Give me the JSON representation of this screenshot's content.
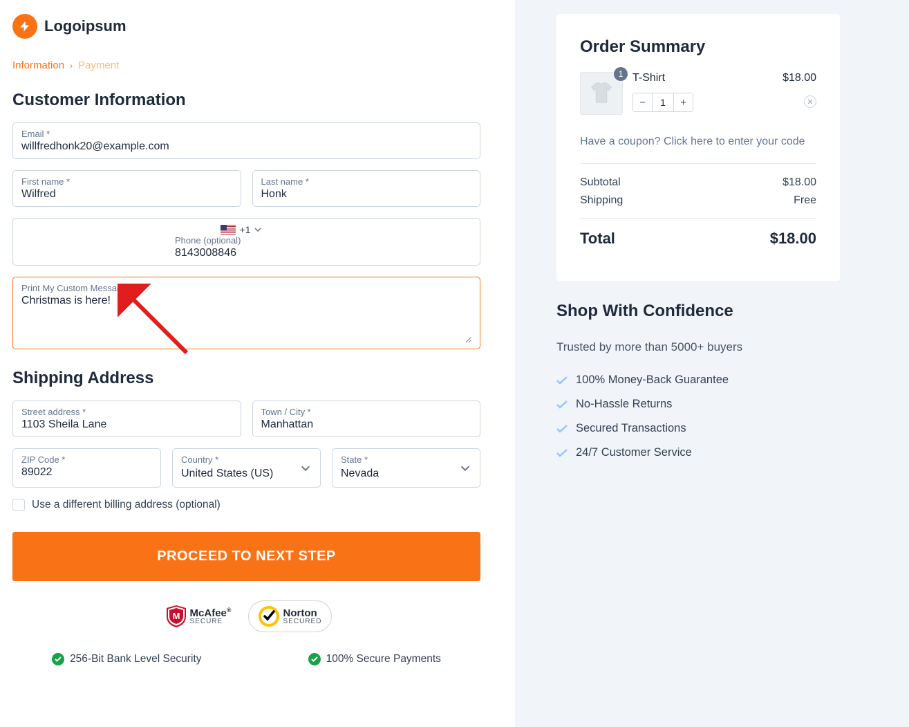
{
  "brand": {
    "name": "Logoipsum"
  },
  "breadcrumb": {
    "step1": "Information",
    "step2": "Payment"
  },
  "sections": {
    "customer_info": "Customer Information",
    "shipping": "Shipping Address"
  },
  "fields": {
    "email": {
      "label": "Email *",
      "value": "willfredhonk20@example.com"
    },
    "first_name": {
      "label": "First name *",
      "value": "Wilfred"
    },
    "last_name": {
      "label": "Last name *",
      "value": "Honk"
    },
    "phone": {
      "label": "Phone (optional)",
      "value": "8143008846",
      "dial": "+1"
    },
    "custom_msg": {
      "label": "Print My Custom Message *",
      "value": "Christmas is here!"
    },
    "street": {
      "label": "Street address *",
      "value": "1103 Sheila Lane"
    },
    "city": {
      "label": "Town / City *",
      "value": "Manhattan"
    },
    "zip": {
      "label": "ZIP Code *",
      "value": "89022"
    },
    "country": {
      "label": "Country *",
      "value": "United States (US)"
    },
    "state": {
      "label": "State *",
      "value": "Nevada"
    },
    "billing_checkbox": "Use a different billing address (optional)"
  },
  "cta": "PROCEED TO NEXT STEP",
  "trust_badges": {
    "mcafee": {
      "main": "McAfee",
      "sub": "SECURE"
    },
    "norton": {
      "main": "Norton",
      "sub": "SECURED"
    }
  },
  "security": {
    "bank": "256-Bit Bank Level Security",
    "payments": "100% Secure Payments"
  },
  "summary": {
    "title": "Order Summary",
    "item": {
      "name": "T-Shirt",
      "price": "$18.00",
      "qty": "1",
      "badge": "1"
    },
    "coupon": "Have a coupon? Click here to enter your code",
    "subtotal_label": "Subtotal",
    "subtotal": "$18.00",
    "shipping_label": "Shipping",
    "shipping": "Free",
    "total_label": "Total",
    "total": "$18.00"
  },
  "confidence": {
    "title": "Shop With Confidence",
    "trust": "Trusted by more than 5000+ buyers",
    "points": [
      "100% Money-Back Guarantee",
      "No-Hassle Returns",
      "Secured Transactions",
      "24/7 Customer Service"
    ]
  }
}
